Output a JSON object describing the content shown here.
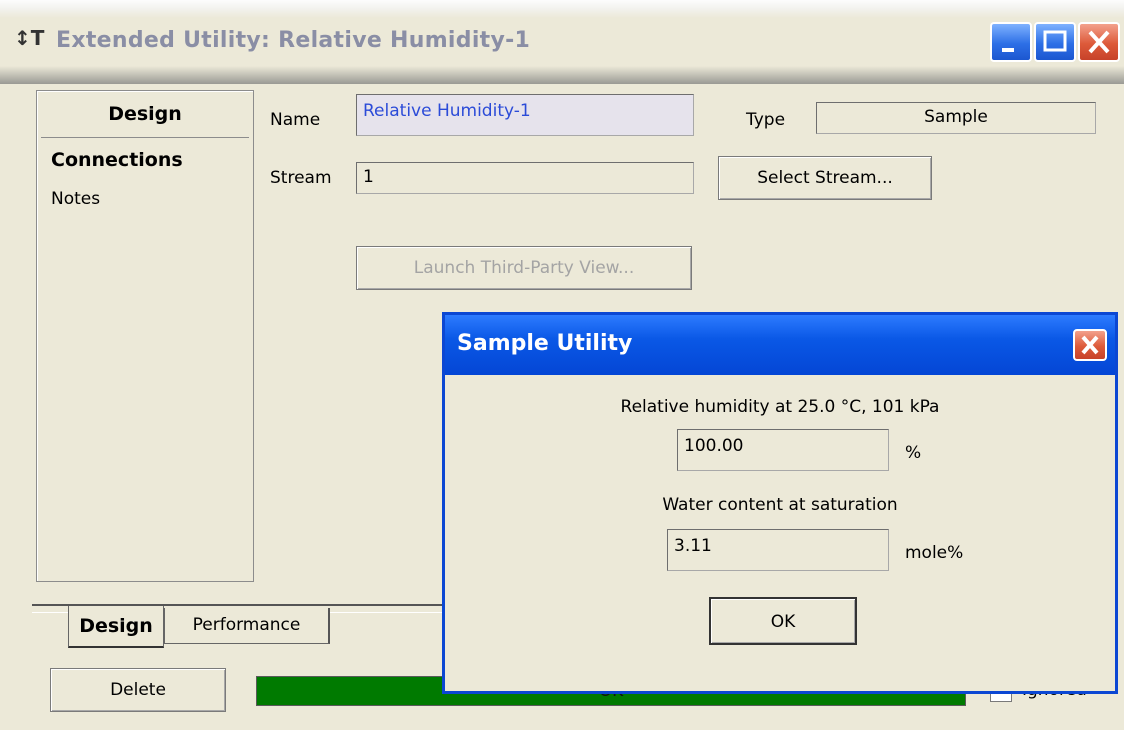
{
  "window": {
    "title": "Extended Utility: Relative Humidity-1",
    "app_icon": "↕T"
  },
  "side_panel": {
    "header": "Design",
    "items": [
      {
        "label": "Connections",
        "selected": true
      },
      {
        "label": "Notes",
        "selected": false
      }
    ]
  },
  "form": {
    "name_label": "Name",
    "name_value": "Relative Humidity-1",
    "type_label": "Type",
    "type_value": "Sample",
    "stream_label": "Stream",
    "stream_value": "1",
    "select_stream_button": "Select Stream...",
    "launch_button": "Launch Third-Party View..."
  },
  "tabs": [
    {
      "label": "Design",
      "active": true
    },
    {
      "label": "Performance",
      "active": false
    }
  ],
  "footer": {
    "delete_button": "Delete",
    "status_text": "OK",
    "status_color": "#007a00",
    "ignored_label": "Ignored",
    "ignored_checked": false
  },
  "dialog": {
    "title": "Sample Utility",
    "rh_label": "Relative humidity at 25.0 °C, 101 kPa",
    "rh_value": "100.00",
    "rh_unit": "%",
    "water_label": "Water content at saturation",
    "water_value": "3.11",
    "water_unit": "mole%",
    "ok_button": "OK"
  }
}
